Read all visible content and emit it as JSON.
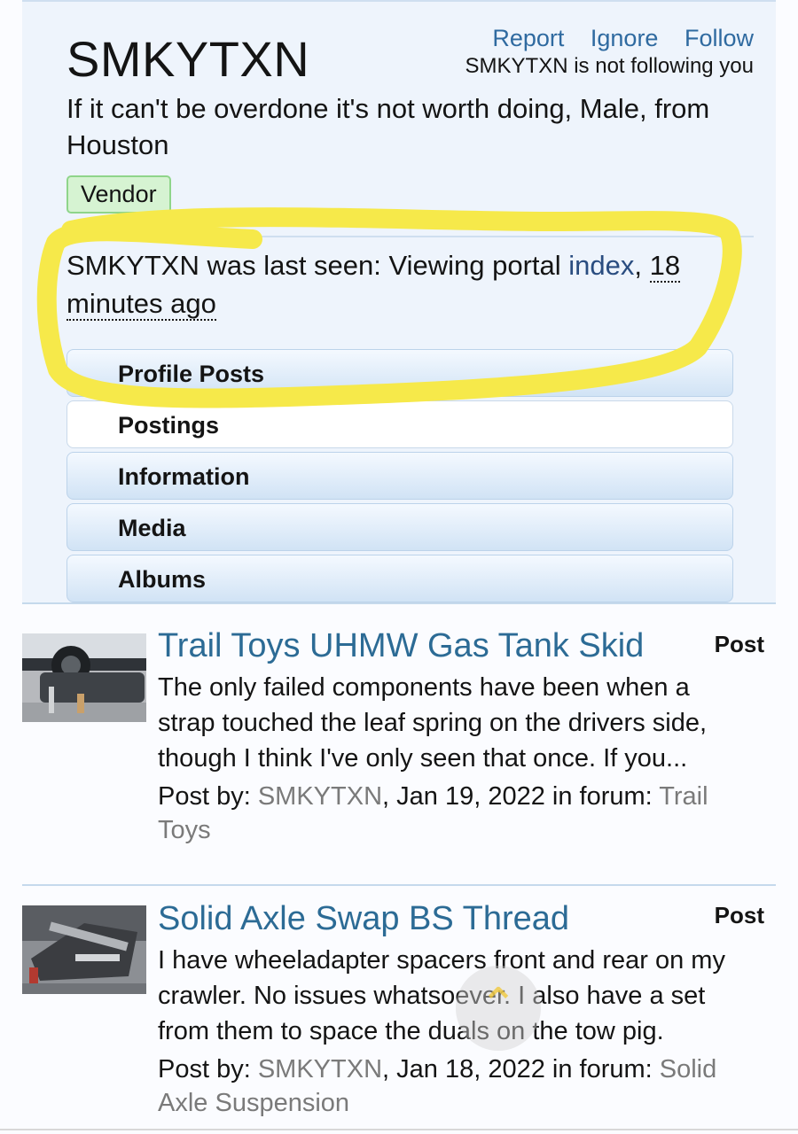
{
  "profile": {
    "username": "SMKYTXN",
    "actions": {
      "report": "Report",
      "ignore": "Ignore",
      "follow": "Follow"
    },
    "follow_status": "SMKYTXN is not following you",
    "tagline": "If it can't be overdone it's not worth doing, Male, from Houston",
    "badge": "Vendor",
    "last_seen": {
      "prefix": "SMKYTXN was last seen: Viewing portal ",
      "link": "index",
      "separator": ", ",
      "time": "18 minutes ago"
    },
    "tabs": [
      "Profile Posts",
      "Postings",
      "Information",
      "Media",
      "Albums"
    ]
  },
  "posts": [
    {
      "title": "Trail Toys UHMW Gas Tank Skid",
      "type": "Post",
      "snippet": "The only failed components have been when a strap touched the leaf spring on the drivers side, though I think I've only seen that once. If you...",
      "by_label": "Post by: ",
      "author": "SMKYTXN",
      "date_text": ", Jan 19, 2022 in forum: ",
      "forum": "Trail Toys"
    },
    {
      "title": "Solid Axle Swap BS Thread",
      "type": "Post",
      "snippet": "I have wheeladapter spacers front and rear on my crawler. No issues whatsoever. I also have a set from them to space the duals on the tow pig.",
      "by_label": "Post by: ",
      "author": "SMKYTXN",
      "date_text": ", Jan 18, 2022 in forum: ",
      "forum": "Solid Axle Suspension"
    }
  ],
  "colors": {
    "link": "#2f6aa0",
    "title": "#2c6b95",
    "highlight": "#f6e94a",
    "vendor_badge": "#d6f3d2"
  },
  "icons": {
    "scroll_top": "chevron-up-icon"
  }
}
